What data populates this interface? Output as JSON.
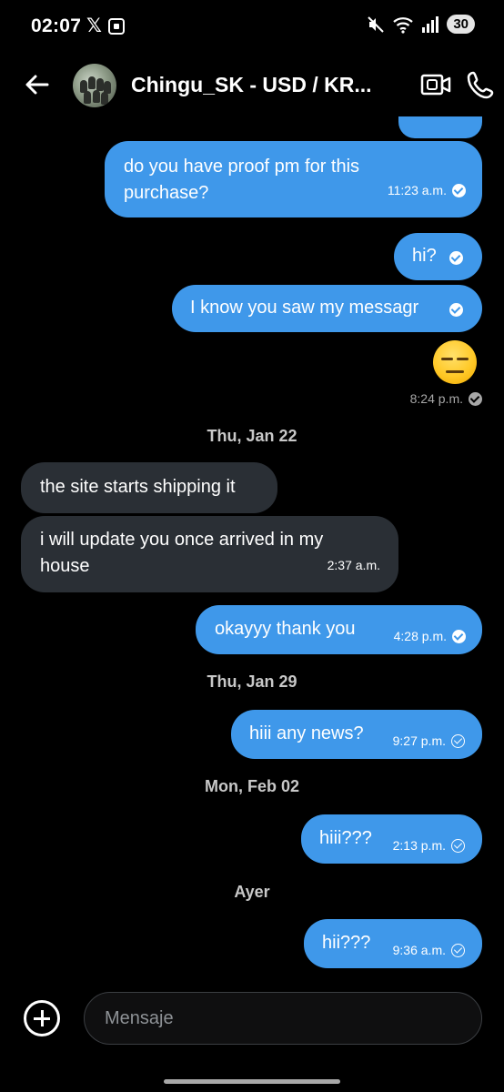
{
  "status_bar": {
    "time": "02:07",
    "x_logo": "𝕏",
    "battery": "30",
    "icons": [
      "x-logo-icon",
      "screenshot-icon",
      "mute-icon",
      "wifi-icon",
      "signal-icon",
      "battery-icon"
    ]
  },
  "header": {
    "title": "Chingu_SK - USD / KR...",
    "icons": [
      "back-arrow-icon",
      "avatar",
      "video-call-icon",
      "phone-call-icon"
    ]
  },
  "messages": [
    {
      "side": "out",
      "text": "do you have proof pm for this purchase?",
      "time": "11:23 a.m.",
      "status": "read"
    },
    {
      "side": "out",
      "text": "hi?",
      "time": "",
      "status": "read"
    },
    {
      "side": "out",
      "text": "I know you saw my messagr",
      "time": "",
      "status": "read"
    },
    {
      "side": "out",
      "emoji": "expressionless-face",
      "time": "8:24 p.m.",
      "status": "read"
    },
    {
      "date": "Thu, Jan 22"
    },
    {
      "side": "in",
      "text": "the site starts shipping it",
      "time": ""
    },
    {
      "side": "in",
      "text": "i will update you once arrived in my house",
      "time": "2:37 a.m."
    },
    {
      "side": "out",
      "text": "okayyy thank you",
      "time": "4:28 p.m.",
      "status": "read"
    },
    {
      "date": "Thu, Jan 29"
    },
    {
      "side": "out",
      "text": "hiii any news?",
      "time": "9:27 p.m.",
      "status": "sent"
    },
    {
      "date": "Mon, Feb 02"
    },
    {
      "side": "out",
      "text": "hiii???",
      "time": "2:13 p.m.",
      "status": "sent"
    },
    {
      "date": "Ayer"
    },
    {
      "side": "out",
      "text": "hii???",
      "time": "9:36 a.m.",
      "status": "sent"
    }
  ],
  "composer": {
    "placeholder": "Mensaje",
    "icons": [
      "add-attachment-icon"
    ]
  },
  "colors": {
    "background": "#000000",
    "outgoing_bubble": "#3f98ea",
    "incoming_bubble": "#2a2f35",
    "date_text": "#c8c8c8"
  }
}
